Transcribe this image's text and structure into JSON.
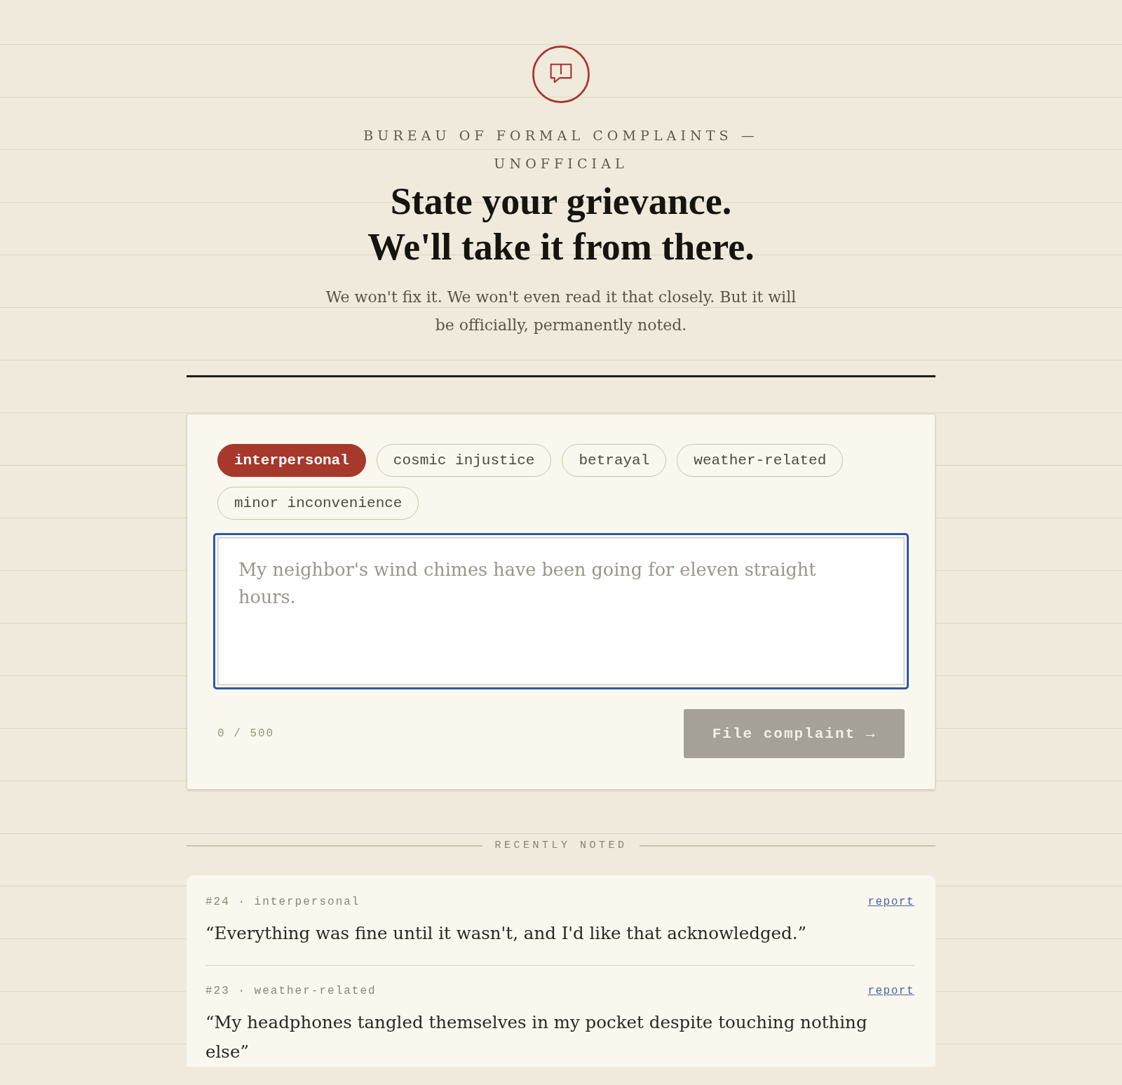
{
  "header": {
    "eyebrow": "BUREAU OF FORMAL COMPLAINTS — UNOFFICIAL",
    "heading_lines": [
      "State your grievance.",
      "We'll take it from there."
    ],
    "subtitle": "We won't fix it. We won't even read it that closely. But it will be officially, permanently noted."
  },
  "form": {
    "tags": [
      {
        "label": "interpersonal",
        "selected": true
      },
      {
        "label": "cosmic injustice",
        "selected": false
      },
      {
        "label": "betrayal",
        "selected": false
      },
      {
        "label": "weather-related",
        "selected": false
      },
      {
        "label": "minor inconvenience",
        "selected": false
      }
    ],
    "complaint_field": {
      "placeholder": "My neighbor's wind chimes have been going for eleven straight hours.",
      "focused": true
    },
    "counter": "0 / 500",
    "submit": {
      "label": "File complaint →",
      "disabled": true
    }
  },
  "recent": {
    "title": "RECENTLY NOTED",
    "items": [
      {
        "meta": "#24 · interpersonal",
        "link": "report",
        "quote": "“Everything was fine until it wasn't, and I'd like that acknowledged.”"
      },
      {
        "meta": "#23 · weather-related",
        "link": "report",
        "quote": "“My headphones tangled themselves in my pocket despite touching nothing else”"
      }
    ]
  }
}
